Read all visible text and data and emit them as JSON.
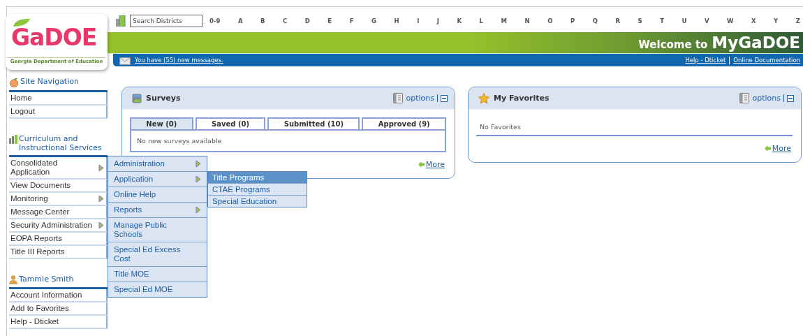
{
  "logo": {
    "mark": "GaDOE",
    "subtitle": "Georgia Department of Education"
  },
  "header": {
    "search": {
      "placeholder": "Search Districts"
    },
    "index": [
      "0-9",
      "A",
      "B",
      "C",
      "D",
      "E",
      "F",
      "G",
      "H",
      "I",
      "J",
      "K",
      "L",
      "M",
      "N",
      "O",
      "P",
      "Q",
      "R",
      "S",
      "T",
      "U",
      "V",
      "W",
      "X",
      "Y",
      "Z"
    ],
    "welcome": "Welcome to",
    "site_name": "MyGaDOE",
    "message": "You have (55) new messages.",
    "links": [
      "Help - Dticket",
      "Online Documentation"
    ]
  },
  "sidebar": {
    "sections": [
      {
        "title": "Site Navigation",
        "items": [
          {
            "label": "Home",
            "submenu": false
          },
          {
            "label": "Logout",
            "submenu": false
          }
        ]
      },
      {
        "title": "Curriculum and Instructional Services",
        "items": [
          {
            "label": "Consolidated Application",
            "submenu": true,
            "children": [
              {
                "label": "Administration",
                "submenu": true
              },
              {
                "label": "Application",
                "submenu": true,
                "children": [
                  {
                    "label": "Title Programs",
                    "selected": true
                  },
                  {
                    "label": "CTAE Programs",
                    "selected": false
                  },
                  {
                    "label": "Special Education",
                    "selected": false
                  }
                ]
              },
              {
                "label": "Online Help",
                "submenu": false
              },
              {
                "label": "Reports",
                "submenu": true
              },
              {
                "label": "Manage Public Schools",
                "submenu": false
              },
              {
                "label": "Special Ed Excess Cost",
                "submenu": false
              },
              {
                "label": "Title MOE",
                "submenu": false
              },
              {
                "label": "Special Ed MOE",
                "submenu": false
              }
            ]
          },
          {
            "label": "View Documents",
            "submenu": false
          },
          {
            "label": "Monitoring",
            "submenu": true
          },
          {
            "label": "Message Center",
            "submenu": false
          },
          {
            "label": "Security Administration",
            "submenu": true
          },
          {
            "label": "EOPA Reports",
            "submenu": false
          },
          {
            "label": "Title III Reports",
            "submenu": false
          }
        ]
      },
      {
        "title": "Tammie Smith",
        "items": [
          {
            "label": "Account Information",
            "submenu": false
          },
          {
            "label": "Add to Favorites",
            "submenu": false
          },
          {
            "label": "Help - Dticket",
            "submenu": false
          }
        ]
      }
    ]
  },
  "panels": [
    {
      "kind": "surveys",
      "title": "Surveys",
      "options": "options",
      "tabs": [
        {
          "label": "New (0)",
          "selected": true
        },
        {
          "label": "Saved (0)",
          "selected": false
        },
        {
          "label": "Submitted (10)",
          "selected": false
        },
        {
          "label": "Approved (9)",
          "selected": false
        }
      ],
      "message": "No new surveys available",
      "more": "More"
    },
    {
      "kind": "favorites",
      "title": "My Favorites",
      "options": "options",
      "message": "No Favorites",
      "more": "More"
    }
  ]
}
